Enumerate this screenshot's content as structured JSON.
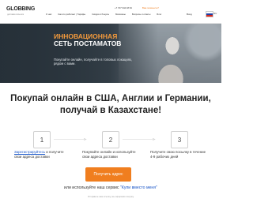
{
  "header": {
    "logo_main": "GLOBBING",
    "logo_sub": "доставка посылок",
    "nav": [
      "О нас",
      "Как это работает | Тарифы",
      "Скидки и бонусы",
      "Магазины",
      "Вопросы и ответы",
      "Блог"
    ],
    "phone": "+7 727 344 18 64",
    "phone_link": "Вам позвонить?",
    "signin": "Вход",
    "lang": "RU"
  },
  "hero": {
    "title_line1": "ИННОВАЦИОННАЯ",
    "title_line2": "СЕТЬ ПОСТАМАТОВ",
    "subtitle": "Покупайте онлайн, получайте в топовых локациях, рядом с вами."
  },
  "main": {
    "heading": "Покупай онлайн в США, Англии и Германии, получай в Казахстане!"
  },
  "steps": [
    {
      "number": "1",
      "link": "Зарегистрируйтесь",
      "text": " и получите свои адреса доставки"
    },
    {
      "number": "2",
      "link": "",
      "text": "Покупайте онлайн и используйте свои адреса доставки"
    },
    {
      "number": "3",
      "link": "",
      "text": "Получите свою посылку в течение 4-9 рабочих дней"
    }
  ],
  "cta": {
    "label": "Получить адрес"
  },
  "alt": {
    "prefix": "или используйте наш сервис ",
    "link": "\"Купи вместо меня\"",
    "note": "Отправьте нам ссылку, мы оформим покупку"
  },
  "colors": {
    "accent": "#f07e1f",
    "link": "#1a56c8",
    "hero_bg": "#3a4650"
  }
}
